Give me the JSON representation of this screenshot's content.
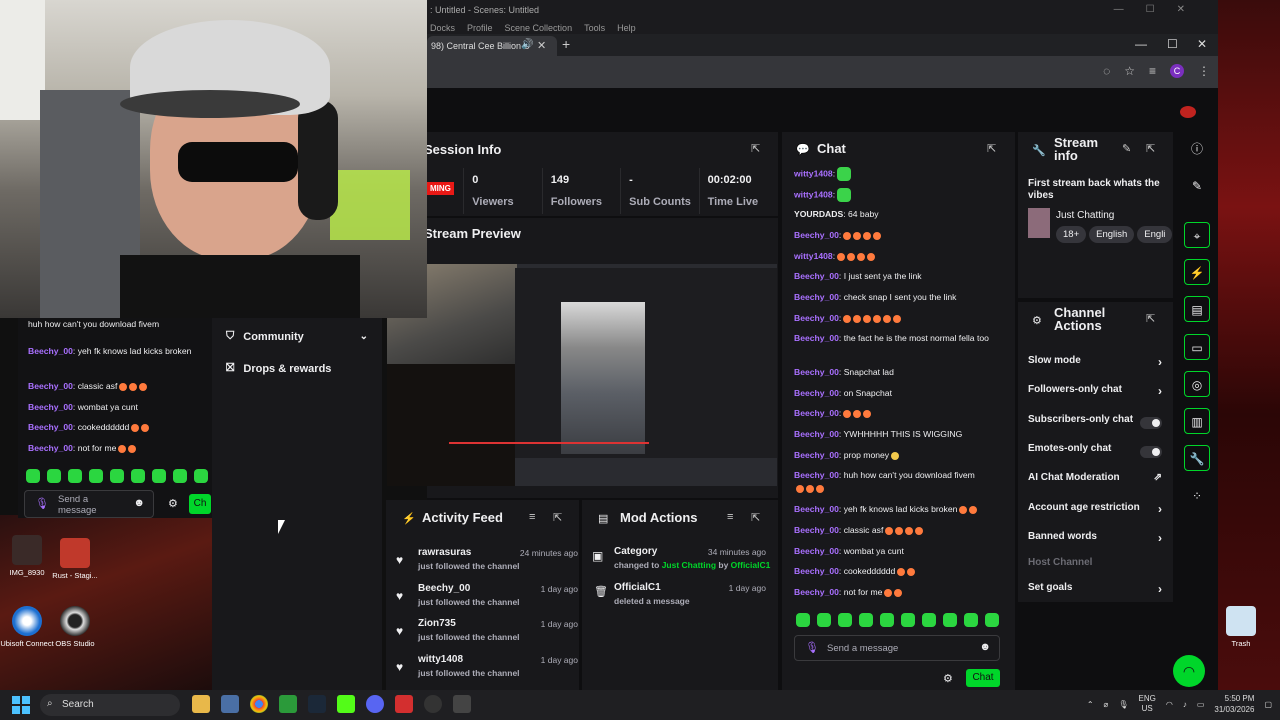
{
  "obs": {
    "title": ": Untitled - Scenes: Untitled",
    "menu": [
      "Docks",
      "Profile",
      "Scene Collection",
      "Tools",
      "Help"
    ]
  },
  "browser": {
    "tab_title": "98) Central Cee Billion S",
    "avatar_letter": "C"
  },
  "session_info": {
    "title": "Session Info",
    "live_badge": "MING",
    "stats": [
      {
        "value": "0",
        "label": "Viewers"
      },
      {
        "value": "149",
        "label": "Followers"
      },
      {
        "value": "-",
        "label": "Sub Counts"
      },
      {
        "value": "00:02:00",
        "label": "Time Live"
      }
    ]
  },
  "stream_preview": {
    "title": "Stream Preview"
  },
  "activity_feed": {
    "title": "Activity Feed",
    "items": [
      {
        "name": "rawrasuras",
        "sub": "just followed the channel",
        "time": "24 minutes ago"
      },
      {
        "name": "Beechy_00",
        "sub": "just followed the channel",
        "time": "1 day ago"
      },
      {
        "name": "Zion735",
        "sub": "just followed the channel",
        "time": "1 day ago"
      },
      {
        "name": "witty1408",
        "sub": "just followed the channel",
        "time": "1 day ago"
      }
    ]
  },
  "mod_actions": {
    "title": "Mod Actions",
    "items": [
      {
        "title": "Category",
        "pre": "changed to ",
        "target": "Just Chatting",
        "mid": " by ",
        "by": "OfficialC1",
        "time": "34 minutes ago"
      },
      {
        "title": "OfficialC1",
        "sub": "deleted a message",
        "time": "1 day ago"
      }
    ]
  },
  "chat": {
    "title": "Chat",
    "messages": [
      {
        "user": "witty1408",
        "text": ":"
      },
      {
        "user": "witty1408",
        "text": ":"
      },
      {
        "user": "YOURDADS",
        "text": ": 64 baby"
      },
      {
        "user": "Beechy_00",
        "text": ":"
      },
      {
        "user": "witty1408",
        "text": ":"
      },
      {
        "user": "Beechy_00",
        "text": ": I just sent ya the link"
      },
      {
        "user": "Beechy_00",
        "text": ": check snap I sent you the link"
      },
      {
        "user": "Beechy_00",
        "text": ":"
      },
      {
        "user": "Beechy_00",
        "text": ": the fact he is the most normal fella too"
      },
      {
        "user": "Beechy_00",
        "text": ": Snapchat lad"
      },
      {
        "user": "Beechy_00",
        "text": ": on Snapchat"
      },
      {
        "user": "Beechy_00",
        "text": ":"
      },
      {
        "user": "Beechy_00",
        "text": ": YWHHHHH THIS IS WIGGING"
      },
      {
        "user": "Beechy_00",
        "text": ": prop money"
      },
      {
        "user": "Beechy_00",
        "text": ": huh how can't you download fivem"
      },
      {
        "user": "Beechy_00",
        "text": ": yeh fk knows lad kicks broken"
      },
      {
        "user": "Beechy_00",
        "text": ": classic asf"
      },
      {
        "user": "Beechy_00",
        "text": ": wombat ya cunt"
      },
      {
        "user": "Beechy_00",
        "text": ": cookedddddd"
      },
      {
        "user": "Beechy_00",
        "text": ": not for me"
      }
    ],
    "placeholder": "Send a message",
    "button": "Chat"
  },
  "stream_info": {
    "title_line1": "Stream",
    "title_line2": "info",
    "stream_title": "First stream back whats the vibes",
    "category": "Just Chatting",
    "tags": [
      "18+",
      "English",
      "Engli"
    ]
  },
  "channel_actions": {
    "title_line1": "Channel",
    "title_line2": "Actions",
    "items": [
      {
        "label": "Slow mode",
        "kind": "chevron"
      },
      {
        "label": "Followers-only chat",
        "kind": "chevron"
      },
      {
        "label": "Subscribers-only chat",
        "kind": "toggle"
      },
      {
        "label": "Emotes-only chat",
        "kind": "toggle"
      },
      {
        "label": "AI Chat Moderation",
        "kind": "external"
      },
      {
        "label": "Account age restriction",
        "kind": "chevron"
      },
      {
        "label": "Banned words",
        "kind": "chevron"
      },
      {
        "label": "Host Channel",
        "kind": "disabled"
      },
      {
        "label": "Set goals",
        "kind": "chevron"
      }
    ]
  },
  "left_chat": {
    "messages": [
      {
        "user": "",
        "text": "huh how can't you download fivem"
      },
      {
        "user": "Beechy_00",
        "text": ": yeh fk knows lad kicks broken"
      },
      {
        "user": "Beechy_00",
        "text": ": classic asf"
      },
      {
        "user": "Beechy_00",
        "text": ": wombat ya cunt"
      },
      {
        "user": "Beechy_00",
        "text": ": cookedddddd"
      },
      {
        "user": "Beechy_00",
        "text": ": not for me"
      }
    ],
    "placeholder": "Send a message",
    "button": "Ch"
  },
  "side_menu": {
    "community": "Community",
    "drops": "Drops & rewards"
  },
  "desktop_icons": [
    {
      "label": "IMG_8930"
    },
    {
      "label": "Rust - Stagi..."
    },
    {
      "label": "Ubisoft Connect"
    },
    {
      "label": "OBS Studio"
    },
    {
      "label": "Trash"
    }
  ],
  "taskbar": {
    "search": "Search",
    "lang": "ENG",
    "region": "US",
    "time": "5:50 PM",
    "date": "31/03/2026"
  }
}
